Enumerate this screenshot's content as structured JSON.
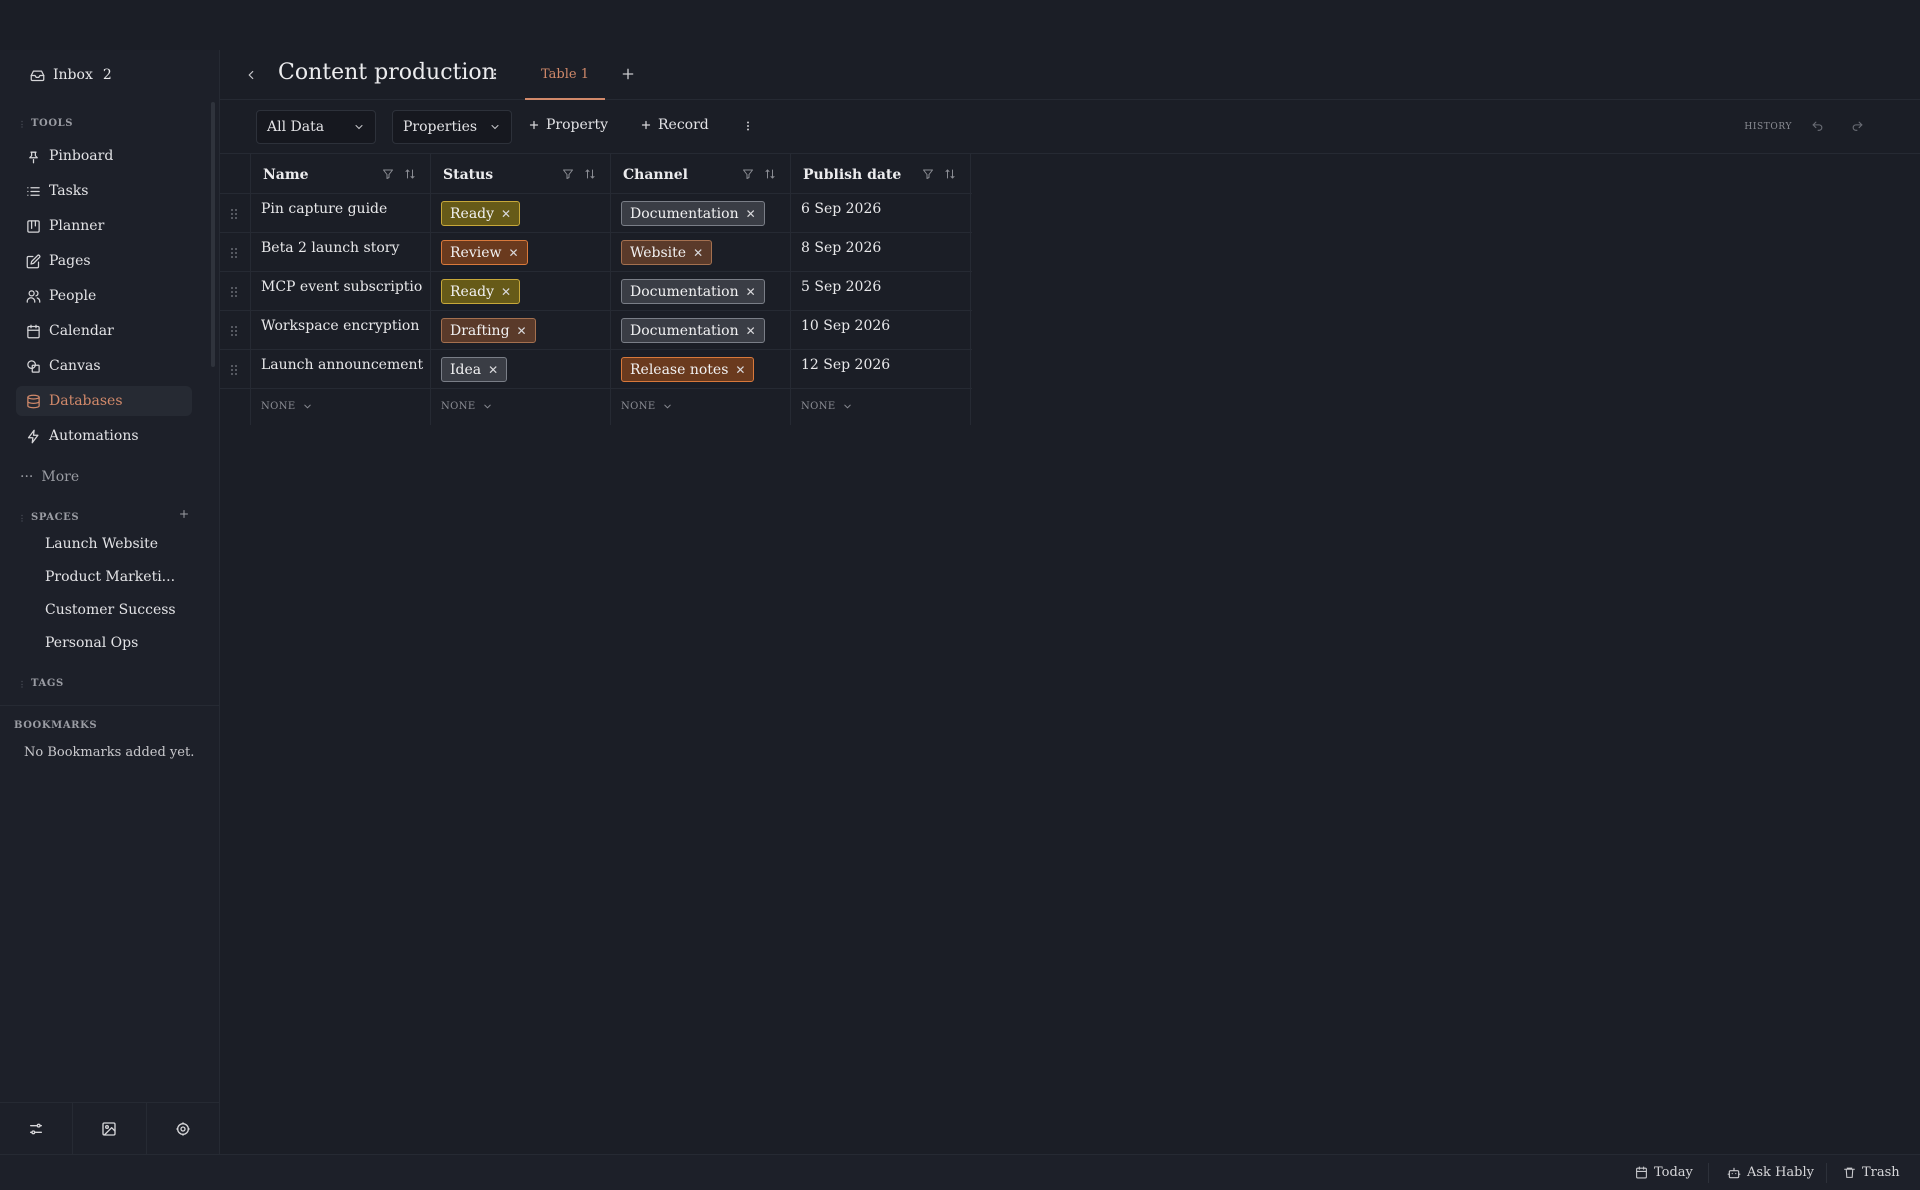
{
  "sidebar": {
    "inbox": {
      "label": "Inbox",
      "count": "2"
    },
    "tools_label": "TOOLS",
    "tools": [
      {
        "label": "Pinboard",
        "icon": "pin-icon"
      },
      {
        "label": "Tasks",
        "icon": "list-icon"
      },
      {
        "label": "Planner",
        "icon": "kanban-icon"
      },
      {
        "label": "Pages",
        "icon": "edit-icon"
      },
      {
        "label": "People",
        "icon": "people-icon"
      },
      {
        "label": "Calendar",
        "icon": "calendar-icon"
      },
      {
        "label": "Canvas",
        "icon": "shapes-icon"
      },
      {
        "label": "Databases",
        "icon": "database-icon",
        "active": true
      },
      {
        "label": "Automations",
        "icon": "bolt-icon"
      }
    ],
    "more_label": "More",
    "spaces_label": "SPACES",
    "spaces": [
      "Launch Website",
      "Product Marketi...",
      "Customer Success",
      "Personal Ops"
    ],
    "tags_label": "TAGS",
    "bookmarks_label": "BOOKMARKS",
    "bookmarks_empty": "No Bookmarks added yet."
  },
  "header": {
    "title": "Content production",
    "tab": "Table 1"
  },
  "toolbar": {
    "view_select": "All Data",
    "properties_select": "Properties",
    "add_property": "Property",
    "add_record": "Record",
    "history": "HISTORY"
  },
  "table": {
    "columns": [
      "Name",
      "Status",
      "Channel",
      "Publish date"
    ],
    "rows": [
      {
        "name": "Pin capture guide",
        "status": "Ready",
        "channel": "Documentation",
        "date": "6 Sep 2026"
      },
      {
        "name": "Beta 2 launch story",
        "status": "Review",
        "channel": "Website",
        "date": "8 Sep 2026"
      },
      {
        "name": "MCP event subscriptions",
        "status": "Ready",
        "channel": "Documentation",
        "date": "5 Sep 2026"
      },
      {
        "name": "Workspace encryption ...",
        "status": "Drafting",
        "channel": "Documentation",
        "date": "10 Sep 2026"
      },
      {
        "name": "Launch announcement",
        "status": "Idea",
        "channel": "Release notes",
        "date": "12 Sep 2026"
      }
    ],
    "footer": [
      "NONE",
      "NONE",
      "NONE",
      "NONE"
    ]
  },
  "statusbar": {
    "today": "Today",
    "ask": "Ask Hably",
    "trash": "Trash"
  },
  "colors": {
    "accent": "#d1896a",
    "background": "#1b1e26",
    "sidebar": "#1d2029"
  }
}
